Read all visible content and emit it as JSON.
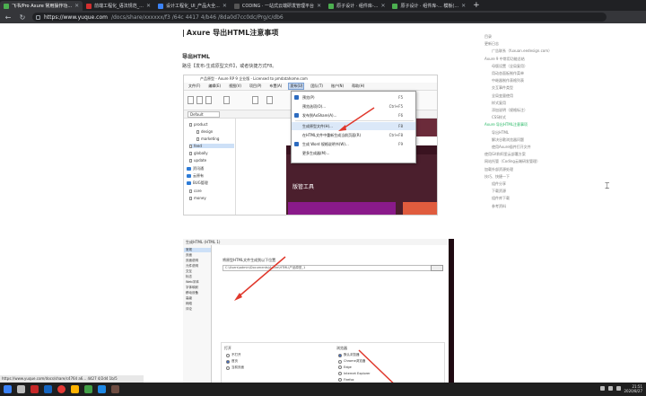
{
  "browser": {
    "tabs": [
      {
        "label": "飞书/Pro Axure 常用操作功...",
        "active": true,
        "favicon": "green"
      },
      {
        "label": "前端工程化_语法规范_...",
        "active": false,
        "favicon": "red"
      },
      {
        "label": "设计工程化_UI_产品大全...",
        "active": false,
        "favicon": "blue"
      },
      {
        "label": "CODING · 一站式云端研发管理平台",
        "active": false,
        "favicon": "dark"
      },
      {
        "label": "原子设计 · 组件库-...",
        "active": false,
        "favicon": "green"
      },
      {
        "label": "原子设计 · 组件库-... 模板(...",
        "active": false,
        "favicon": "green"
      }
    ],
    "url_host": "https://www.yuque.com",
    "url_path": "/docs/share/xxxxxx/f3 /64c 4417 4/b46 /8da0d7cc0dc/Prg/c/db6"
  },
  "article": {
    "title": "Axure 导出HTML注意事项",
    "section_title": "导出HTML",
    "paragraph": "路径【发布-生成原型文件】，或者快捷方式F8。"
  },
  "axure_window": {
    "title": "产品原型 - Axure RP 9 企业版 - Licensed to pmdatahome.com",
    "menus": [
      "文件(F)",
      "编辑(E)",
      "视图(V)",
      "项目(P)",
      "布置(A)",
      "发布(U)",
      "团队(T)",
      "账户(N)",
      "帮助(H)"
    ],
    "active_menu": "发布(U)",
    "style_select": "Default",
    "tree": [
      {
        "label": "product",
        "type": "page"
      },
      {
        "label": "design",
        "type": "page"
      },
      {
        "label": "marketing",
        "type": "page"
      },
      {
        "label": "feed",
        "type": "page",
        "selected": true
      },
      {
        "label": "globally",
        "type": "page"
      },
      {
        "label": "update",
        "type": "page"
      },
      {
        "label": "资讯通",
        "type": "folder"
      },
      {
        "label": "云原有",
        "type": "folder"
      },
      {
        "label": "BUG管理",
        "type": "folder"
      },
      {
        "label": "core",
        "type": "page"
      },
      {
        "label": "money",
        "type": "page"
      }
    ],
    "canvas_label": "版管工具",
    "publish_menu": [
      {
        "label": "预览(P)",
        "shortcut": "F5",
        "icon": true
      },
      {
        "label": "预览选项(O)...",
        "shortcut": "Ctrl+F5",
        "icon": false
      },
      {
        "label": "发布到AxShare(A)...",
        "shortcut": "F6",
        "icon": true
      },
      {
        "label": "生成原型文件(H)...",
        "shortcut": "F8",
        "icon": false,
        "highlighted": true
      },
      {
        "label": "在HTML文件中重新生成当前页面(R)",
        "shortcut": "Ctrl+F8",
        "icon": false
      },
      {
        "label": "生成 Word 规格说明书(W)...",
        "shortcut": "F9",
        "icon": true
      },
      {
        "label": "更多生成器(M)...",
        "shortcut": "",
        "icon": false
      }
    ]
  },
  "html_dialog": {
    "title": "生成HTML (HTML 1)",
    "nav": [
      "常规",
      "页面",
      "页面说明",
      "元件说明",
      "交互",
      "标志",
      "Web字体",
      "字体映射",
      "移动设备",
      "高级",
      "网络",
      "评论"
    ],
    "selected_nav": "常规",
    "label_path": "将原型HTML文件生成到以下位置",
    "path_value": "C:\\Users\\admin\\Documents\\Axure\\HTML\\产品原型_1",
    "label_open": "打开",
    "label_browser": "浏览器",
    "open_options": [
      "不打开",
      "首页",
      "当前页面"
    ],
    "browser_options": [
      "默认浏览器",
      "Chrome浏览器",
      "Edge",
      "Internet Explorer",
      "Firefox"
    ]
  },
  "toc": {
    "items": [
      {
        "label": "目录",
        "indent": 0
      },
      {
        "label": "更新日志",
        "indent": 0
      },
      {
        "label": "广告联系（fuxuan.eedesign.com）",
        "indent": 1
      },
      {
        "label": "Axure 9 中常用功能总结",
        "indent": 0
      },
      {
        "label": "母版设置（全局复用）",
        "indent": 1
      },
      {
        "label": "用动态面板制作菜单",
        "indent": 1
      },
      {
        "label": "中继器制作表格列表",
        "indent": 1
      },
      {
        "label": "交互事件类型",
        "indent": 1
      },
      {
        "label": "全局变量使用",
        "indent": 1
      },
      {
        "label": "样式复用",
        "indent": 1
      },
      {
        "label": "添加说明（规格标注）",
        "indent": 1
      },
      {
        "label": "CSS样式",
        "indent": 1
      },
      {
        "label": "Axure 导出HTML注意事项",
        "indent": 0,
        "active": true
      },
      {
        "label": "导出HTML",
        "indent": 1
      },
      {
        "label": "解决谷歌浏览器问题",
        "indent": 1
      },
      {
        "label": "使用Axure插件打开文件",
        "indent": 1
      },
      {
        "label": "使用Git和阿里云部署方案",
        "indent": 0
      },
      {
        "label": "网站托管（Coding云端研发管理）",
        "indent": 0
      },
      {
        "label": "加载外部资源处理",
        "indent": 0
      },
      {
        "label": "技巧、快捷一下",
        "indent": 0
      },
      {
        "label": "组件分享",
        "indent": 1
      },
      {
        "label": "下载资源",
        "indent": 1
      },
      {
        "label": "组件库下载",
        "indent": 1
      },
      {
        "label": "参考资料",
        "indent": 1
      }
    ]
  },
  "status_url": "https://www.yuque.com/docs/share/c4764 a6... 4427 4/2d4 1b/5",
  "tray": {
    "time": "21:51",
    "date": "2020/8/27"
  }
}
